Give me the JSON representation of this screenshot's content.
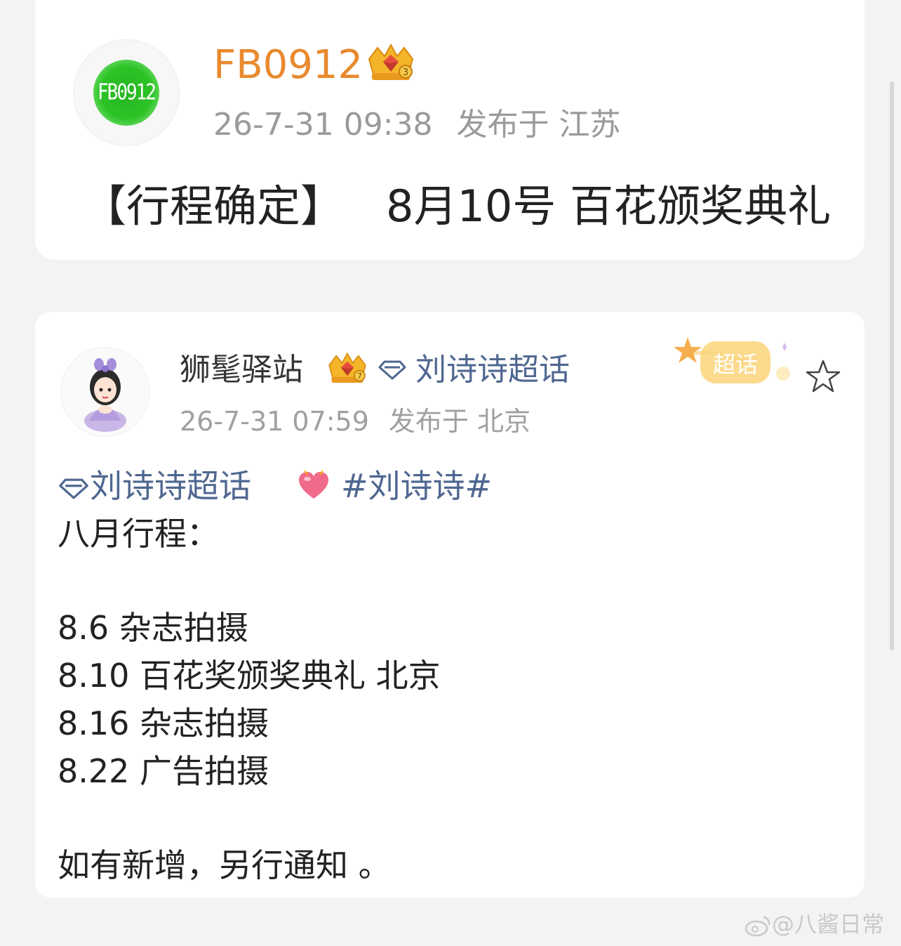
{
  "post1": {
    "avatar_text": "FB0912",
    "username": "FB0912",
    "badge_level": "3",
    "timestamp": "26-7-31 09:38",
    "location": "发布于 江苏",
    "title_bracket": "【行程确定】",
    "title_text": "8月10号 百花颁奖典礼"
  },
  "post2": {
    "username": "狮髦驿站",
    "badge_level": "7",
    "topic": "刘诗诗超话",
    "timestamp": "26-7-31 07:59",
    "location": "发布于 北京",
    "chaohua_badge": "超话",
    "body": {
      "topic_link": "刘诗诗超话",
      "hashtag": "#刘诗诗#",
      "heading": "八月行程：",
      "schedule": [
        "8.6 杂志拍摄",
        "8.10 百花奖颁奖典礼 北京",
        "8.16 杂志拍摄",
        "8.22 广告拍摄"
      ],
      "footer": "如有新增，另行通知 。"
    }
  },
  "watermark": "@八酱日常",
  "colors": {
    "username_orange": "#e88a2e",
    "topic_blue": "#4f6790",
    "meta_gray": "#9a9a9a",
    "avatar_green": "#2cc326"
  },
  "icons": [
    "crown-badge-icon",
    "diamond-topic-icon",
    "heart-emoji-icon",
    "star-icon",
    "weibo-logo-icon"
  ]
}
